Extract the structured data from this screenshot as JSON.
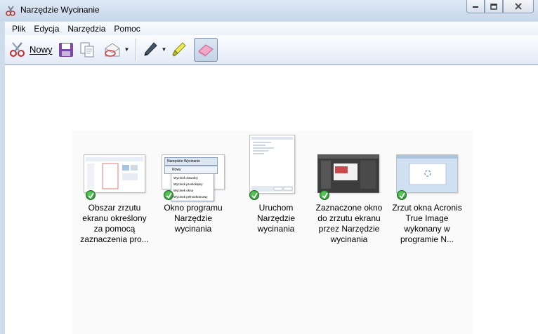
{
  "window": {
    "title": "Narzędzie Wycinanie"
  },
  "menu": [
    "Plik",
    "Edycja",
    "Narzędzia",
    "Pomoc"
  ],
  "toolbar": {
    "new_label": "Nowy",
    "icons": [
      "scissors-icon",
      "save-icon",
      "copy-icon",
      "send-email-icon",
      "pen-icon",
      "highlighter-icon",
      "eraser-icon"
    ]
  },
  "thumbnails": [
    {
      "caption": "Obszar zrzutu ekranu określony za pomocą zaznaczenia pro...",
      "icon": "screenshot-thumbnail"
    },
    {
      "caption": "Okno programu Narzędzie wycinania",
      "icon": "screenshot-thumbnail"
    },
    {
      "caption": "Uruchom Narzędzie wycinania",
      "icon": "screenshot-thumbnail"
    },
    {
      "caption": "Zaznaczone okno do zrzutu ekranu przez Narzędzie wycinania",
      "icon": "screenshot-thumbnail"
    },
    {
      "caption": "Zrzut okna Acronis True Image wykonany w programie N...",
      "icon": "screenshot-thumbnail"
    }
  ],
  "thumbnail_menu": {
    "title": "Narzędzie Wycinanie",
    "new_label": "Nowy",
    "items": [
      "Wycinek dowolny",
      "Wycinek prostokątny",
      "Wycinek okna",
      "Wycinek pełnoekranowy"
    ]
  }
}
